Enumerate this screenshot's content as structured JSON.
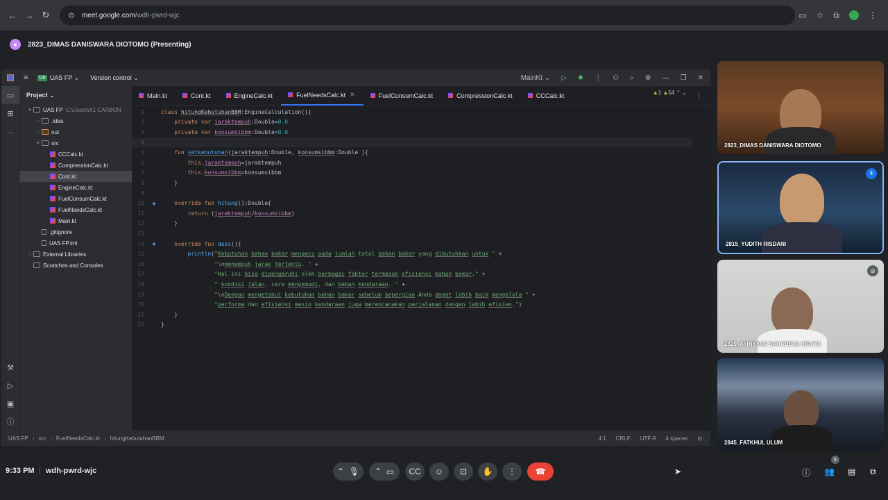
{
  "browser": {
    "url_host": "meet.google.com",
    "url_path": "/wdh-pwrd-wjc",
    "icons": [
      "back-icon",
      "forward-icon",
      "reload-icon",
      "tune-icon",
      "camera-off-icon",
      "star-icon",
      "extensions-icon",
      "profile-icon",
      "more-icon"
    ]
  },
  "presenter": {
    "label": "2823_DIMAS DANISWARA DIOTOMO (Presenting)"
  },
  "ide": {
    "project_badge": "UF",
    "project_name": "UAS FP",
    "version_control": "Version control",
    "run_config": "MainKt",
    "panel_title": "Project",
    "tree": [
      {
        "label": "UAS FP",
        "path": "C:\\Users\\X1 CARBON",
        "indent": 0,
        "arrow": "▾",
        "icon": "folder"
      },
      {
        "label": ".idea",
        "indent": 1,
        "arrow": "›",
        "icon": "folder"
      },
      {
        "label": "out",
        "indent": 1,
        "arrow": "›",
        "icon": "folder-excl"
      },
      {
        "label": "src",
        "indent": 1,
        "arrow": "▾",
        "icon": "folder"
      },
      {
        "label": "CCCalc.kt",
        "indent": 2,
        "icon": "kt"
      },
      {
        "label": "CompressionCalc.kt",
        "indent": 2,
        "icon": "kt"
      },
      {
        "label": "Cont.kt",
        "indent": 2,
        "icon": "kt",
        "selected": true
      },
      {
        "label": "EngineCalc.kt",
        "indent": 2,
        "icon": "kt"
      },
      {
        "label": "FuelConsumCalc.kt",
        "indent": 2,
        "icon": "kt"
      },
      {
        "label": "FuelNeedsCalc.kt",
        "indent": 2,
        "icon": "kt"
      },
      {
        "label": "Main.kt",
        "indent": 2,
        "icon": "kt"
      },
      {
        "label": ".gitignore",
        "indent": 1,
        "icon": "file"
      },
      {
        "label": "UAS FP.iml",
        "indent": 1,
        "icon": "file"
      },
      {
        "label": "External Libraries",
        "indent": 0,
        "arrow": "›",
        "icon": "folder"
      },
      {
        "label": "Scratches and Consoles",
        "indent": 0,
        "icon": "folder"
      }
    ],
    "tabs": [
      {
        "label": "Main.kt"
      },
      {
        "label": "Cont.kt"
      },
      {
        "label": "EngineCalc.kt"
      },
      {
        "label": "FuelNeedsCalc.kt",
        "active": true
      },
      {
        "label": "FuelConsumCalc.kt"
      },
      {
        "label": "CompressionCalc.kt"
      },
      {
        "label": "CCCalc.kt"
      }
    ],
    "warnings": "1",
    "weak_warnings": "54",
    "status": {
      "breadcrumb": [
        "UAS FP",
        "src",
        "FuelNeedsCalc.kt",
        "hitungKebutuhanBBM"
      ],
      "position": "4:1",
      "line_sep": "CRLF",
      "encoding": "UTF-8",
      "indent": "4 spaces"
    }
  },
  "participants": [
    {
      "name": "2823_DIMAS DANISWARA DIOTOMO",
      "mic": "none"
    },
    {
      "name": "2815_YUDITH RISDANI",
      "mic": "speaking"
    },
    {
      "name": "2820_ATHIYYAN SAHADEVA HIDAYA",
      "mic": "muted"
    },
    {
      "name": "2845_FATKHUL ULUM",
      "mic": "none"
    }
  ],
  "meeting": {
    "time": "9:33 PM",
    "code": "wdh-pwrd-wjc",
    "people_count": "5",
    "end_color": "#ea4335",
    "accent": "#1a73e8"
  }
}
